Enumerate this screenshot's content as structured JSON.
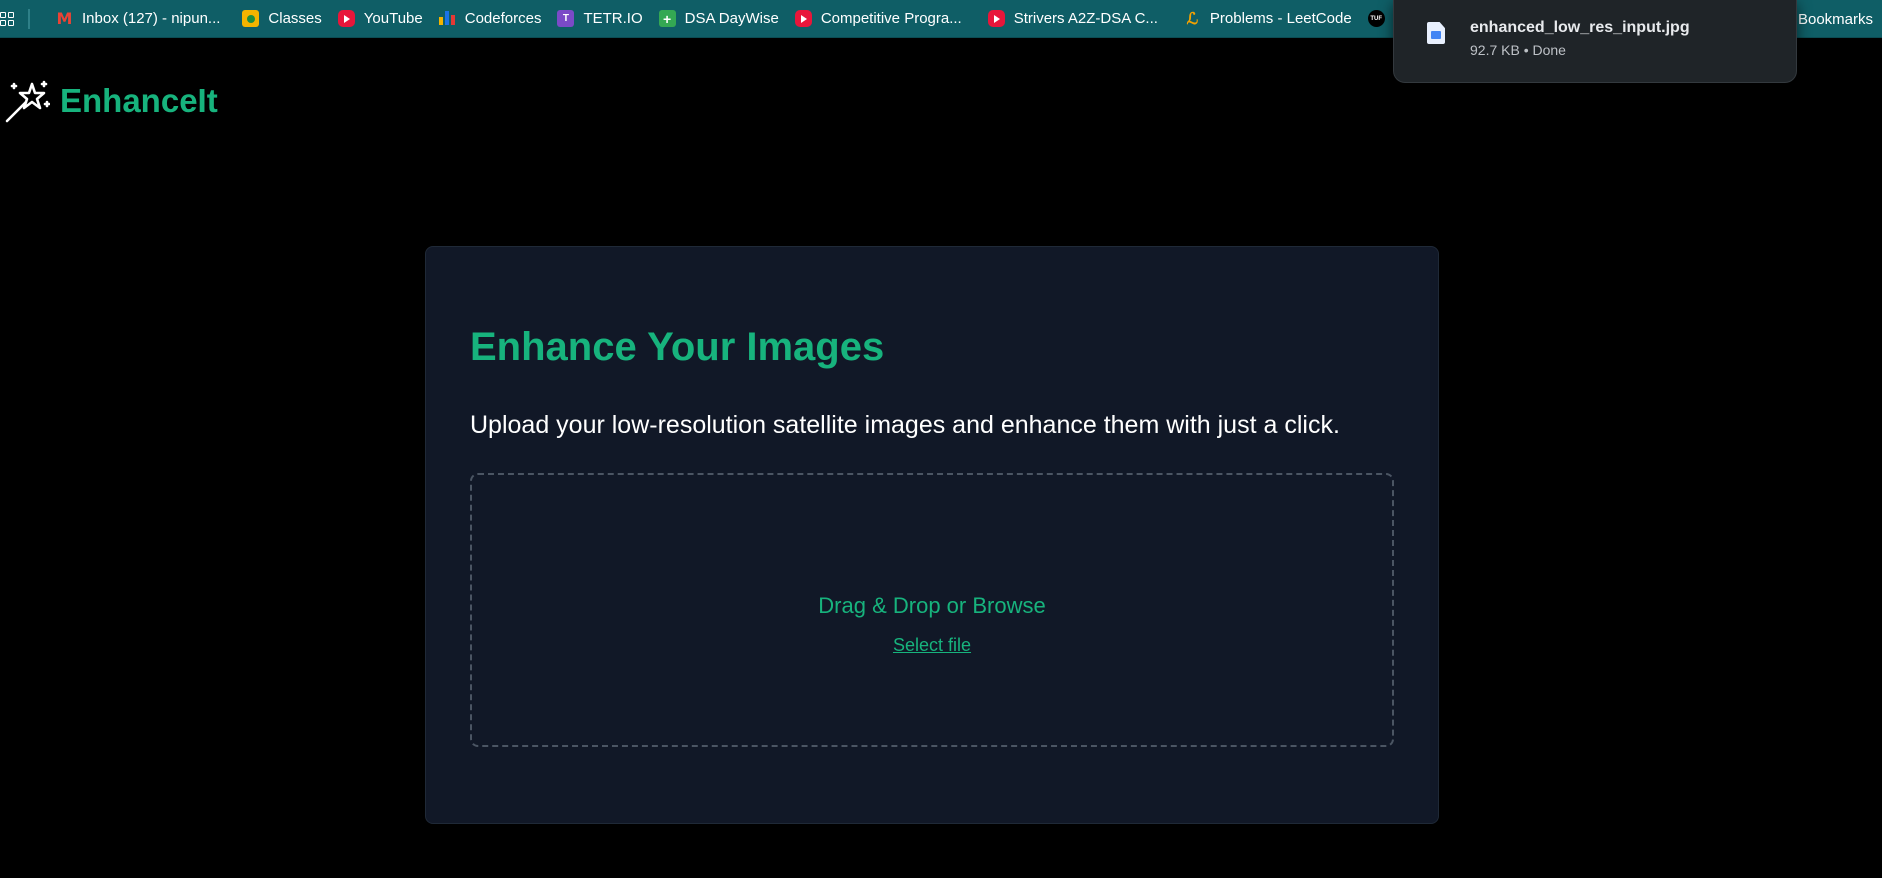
{
  "bookmarks": [
    {
      "label": "Inbox (127) - nipun...",
      "icon": "gmail-icon"
    },
    {
      "label": "Classes",
      "icon": "google-classroom-icon"
    },
    {
      "label": "YouTube",
      "icon": "youtube-icon"
    },
    {
      "label": "Codeforces",
      "icon": "codeforces-icon"
    },
    {
      "label": "TETR.IO",
      "icon": "tetrio-icon"
    },
    {
      "label": "DSA DayWise",
      "icon": "google-sheets-icon"
    },
    {
      "label": "Competitive Progra...",
      "icon": "youtube-icon"
    },
    {
      "label": "Strivers A2Z-DSA C...",
      "icon": "youtube-icon"
    },
    {
      "label": "Problems - LeetCode",
      "icon": "leetcode-icon"
    }
  ],
  "bookmarks_folder": {
    "label": "Bookmarks"
  },
  "download": {
    "filename": "enhanced_low_res_input.jpg",
    "status": "92.7 KB • Done",
    "icon": "image-file-icon"
  },
  "app": {
    "name": "EnhanceIt",
    "icon": "magic-wand-icon",
    "accent_color": "#17b37d"
  },
  "card": {
    "title": "Enhance Your Images",
    "subtitle": "Upload your low-resolution satellite images and enhance them with just a click.",
    "dropzone_text": "Drag & Drop or Browse",
    "select_label": "Select file"
  }
}
